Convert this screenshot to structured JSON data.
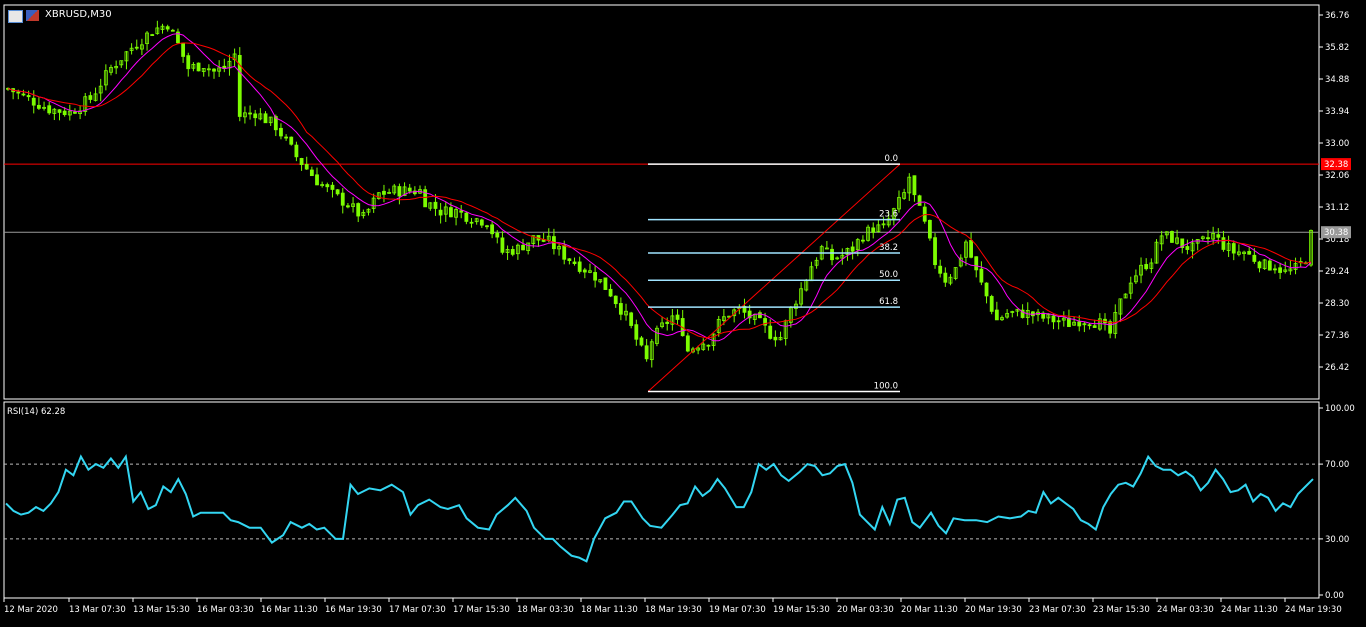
{
  "window": {
    "symbol_timeframe": "XBRUSD,M30"
  },
  "colors": {
    "background": "#000000",
    "frame": "#ffffff",
    "candle": "#7cfc00",
    "ma_fast": "#ff00ff",
    "ma_slow": "#ff0000",
    "price_line": "#ff0000",
    "current_line": "#9a9a9a",
    "fib": "#ffffff",
    "fib_lines": "#a0e4ff",
    "rsi": "#33d6f2",
    "text": "#ffffff",
    "bid_tag_bg": "#ff0000",
    "ask_tag_bg": "#9a9a9a"
  },
  "chart_data": [
    {
      "type": "candlestick",
      "title": "XBRUSD,M30",
      "ylim": [
        25.95,
        36.95
      ],
      "y_ticks": [
        "36.76",
        "35.82",
        "34.88",
        "33.94",
        "33.00",
        "32.06",
        "31.12",
        "30.18",
        "29.24",
        "28.30",
        "27.36",
        "26.42"
      ],
      "x_ticks": [
        "12 Mar 2020",
        "13 Mar 07:30",
        "13 Mar 15:30",
        "16 Mar 03:30",
        "16 Mar 11:30",
        "16 Mar 19:30",
        "17 Mar 07:30",
        "17 Mar 15:30",
        "18 Mar 03:30",
        "18 Mar 11:30",
        "18 Mar 19:30",
        "19 Mar 07:30",
        "19 Mar 15:30",
        "20 Mar 03:30",
        "20 Mar 11:30",
        "20 Mar 19:30",
        "23 Mar 07:30",
        "23 Mar 15:30",
        "24 Mar 03:30",
        "24 Mar 11:30",
        "24 Mar 19:30"
      ],
      "price_levels": [
        {
          "label": "32.38",
          "value": 32.38,
          "role": "bid"
        },
        {
          "label": "30.38",
          "value": 30.38,
          "role": "ask"
        }
      ],
      "fibonacci": {
        "levels": [
          {
            "label": "0.0",
            "value": 32.38
          },
          {
            "label": "23.6",
            "value": 30.75
          },
          {
            "label": "38.2",
            "value": 29.77
          },
          {
            "label": "50.0",
            "value": 28.97
          },
          {
            "label": "61.8",
            "value": 28.18
          },
          {
            "label": "100.0",
            "value": 25.7
          }
        ]
      },
      "price_path": [
        [
          0,
          34.6
        ],
        [
          4,
          34.3
        ],
        [
          8,
          34.0
        ],
        [
          12,
          33.9
        ],
        [
          16,
          34.3
        ],
        [
          20,
          35.2
        ],
        [
          24,
          35.8
        ],
        [
          28,
          36.3
        ],
        [
          31,
          36.5
        ],
        [
          33,
          35.9
        ],
        [
          35,
          35.2
        ],
        [
          38,
          35.3
        ],
        [
          40,
          35.1
        ],
        [
          42,
          35.2
        ],
        [
          44,
          35.6
        ],
        [
          45,
          33.8
        ],
        [
          48,
          33.9
        ],
        [
          52,
          33.5
        ],
        [
          56,
          32.6
        ],
        [
          60,
          31.9
        ],
        [
          63,
          31.5
        ],
        [
          66,
          31.2
        ],
        [
          69,
          30.8
        ],
        [
          72,
          31.5
        ],
        [
          75,
          31.6
        ],
        [
          78,
          31.6
        ],
        [
          80,
          31.6
        ],
        [
          81,
          31.3
        ],
        [
          84,
          31.0
        ],
        [
          87,
          31.0
        ],
        [
          90,
          30.8
        ],
        [
          93,
          30.7
        ],
        [
          96,
          29.8
        ],
        [
          99,
          29.9
        ],
        [
          102,
          30.2
        ],
        [
          105,
          30.1
        ],
        [
          108,
          29.7
        ],
        [
          111,
          29.4
        ],
        [
          114,
          29.1
        ],
        [
          117,
          28.6
        ],
        [
          120,
          27.9
        ],
        [
          123,
          26.9
        ],
        [
          124,
          26.6
        ],
        [
          125,
          27.2
        ],
        [
          127,
          27.6
        ],
        [
          129,
          27.9
        ],
        [
          131,
          27.5
        ],
        [
          132,
          26.9
        ],
        [
          134,
          27.1
        ],
        [
          136,
          27.2
        ],
        [
          138,
          27.7
        ],
        [
          140,
          28.0
        ],
        [
          142,
          28.1
        ],
        [
          144,
          27.9
        ],
        [
          146,
          27.7
        ],
        [
          148,
          27.4
        ],
        [
          150,
          27.3
        ],
        [
          152,
          28.1
        ],
        [
          154,
          28.7
        ],
        [
          156,
          29.4
        ],
        [
          158,
          29.9
        ],
        [
          160,
          29.6
        ],
        [
          162,
          29.7
        ],
        [
          164,
          29.9
        ],
        [
          166,
          30.3
        ],
        [
          168,
          30.5
        ],
        [
          170,
          30.5
        ],
        [
          172,
          31.0
        ],
        [
          174,
          31.5
        ],
        [
          175,
          32.0
        ],
        [
          176,
          31.4
        ],
        [
          178,
          30.6
        ],
        [
          180,
          29.5
        ],
        [
          182,
          29.0
        ],
        [
          184,
          29.3
        ],
        [
          186,
          30.1
        ],
        [
          188,
          29.2
        ],
        [
          190,
          28.5
        ],
        [
          192,
          27.8
        ],
        [
          194,
          28.0
        ],
        [
          196,
          28.0
        ],
        [
          198,
          28.0
        ],
        [
          200,
          27.9
        ],
        [
          203,
          27.8
        ],
        [
          206,
          27.7
        ],
        [
          208,
          27.8
        ],
        [
          210,
          27.8
        ],
        [
          212,
          27.7
        ],
        [
          214,
          27.4
        ],
        [
          216,
          28.3
        ],
        [
          218,
          29.0
        ],
        [
          220,
          29.3
        ],
        [
          222,
          29.6
        ],
        [
          224,
          30.3
        ],
        [
          226,
          30.2
        ],
        [
          228,
          30.0
        ],
        [
          230,
          29.9
        ],
        [
          232,
          30.1
        ],
        [
          234,
          30.3
        ],
        [
          236,
          30.0
        ],
        [
          238,
          29.8
        ],
        [
          240,
          29.8
        ],
        [
          242,
          29.6
        ],
        [
          244,
          29.4
        ],
        [
          246,
          29.4
        ],
        [
          248,
          29.2
        ],
        [
          250,
          29.3
        ],
        [
          252,
          29.6
        ],
        [
          253,
          30.3
        ]
      ],
      "x_count": 253
    },
    {
      "type": "line",
      "title": "RSI(14) 62.28",
      "series": [
        {
          "name": "RSI(14)"
        }
      ],
      "ylim": [
        0,
        100
      ],
      "y_ticks": [
        "100.00",
        "70.00",
        "30.00",
        "0.00"
      ],
      "levels": [
        70,
        30
      ],
      "values_path": [
        [
          0,
          49
        ],
        [
          2,
          45
        ],
        [
          4,
          43
        ],
        [
          6,
          44
        ],
        [
          8,
          47
        ],
        [
          10,
          45
        ],
        [
          12,
          49
        ],
        [
          14,
          55
        ],
        [
          16,
          67
        ],
        [
          18,
          64
        ],
        [
          20,
          74
        ],
        [
          22,
          67
        ],
        [
          24,
          70
        ],
        [
          26,
          68
        ],
        [
          28,
          73
        ],
        [
          30,
          68
        ],
        [
          32,
          74
        ],
        [
          34,
          50
        ],
        [
          36,
          55
        ],
        [
          38,
          46
        ],
        [
          40,
          48
        ],
        [
          42,
          58
        ],
        [
          44,
          55
        ],
        [
          46,
          62
        ],
        [
          48,
          54
        ],
        [
          50,
          42
        ],
        [
          52,
          44
        ],
        [
          55,
          44
        ],
        [
          58,
          44
        ],
        [
          60,
          40
        ],
        [
          62,
          39
        ],
        [
          65,
          36
        ],
        [
          68,
          36
        ],
        [
          71,
          28
        ],
        [
          74,
          32
        ],
        [
          76,
          39
        ],
        [
          79,
          36
        ],
        [
          81,
          38
        ],
        [
          83,
          35
        ],
        [
          85,
          36
        ],
        [
          88,
          30
        ],
        [
          90,
          30
        ],
        [
          92,
          59
        ],
        [
          94,
          54
        ],
        [
          97,
          57
        ],
        [
          100,
          56
        ],
        [
          103,
          59
        ],
        [
          106,
          55
        ],
        [
          108,
          43
        ],
        [
          110,
          48
        ],
        [
          113,
          51
        ],
        [
          116,
          47
        ],
        [
          118,
          46
        ],
        [
          121,
          48
        ],
        [
          123,
          41
        ],
        [
          126,
          36
        ],
        [
          129,
          35
        ],
        [
          131,
          43
        ],
        [
          134,
          48
        ],
        [
          136,
          52
        ],
        [
          139,
          45
        ],
        [
          141,
          36
        ],
        [
          144,
          30
        ],
        [
          146,
          30
        ],
        [
          148,
          26
        ],
        [
          151,
          21
        ],
        [
          153,
          20
        ],
        [
          155,
          18
        ],
        [
          157,
          30
        ],
        [
          160,
          41
        ],
        [
          163,
          44
        ],
        [
          165,
          50
        ],
        [
          167,
          50
        ],
        [
          170,
          41
        ],
        [
          172,
          37
        ],
        [
          175,
          36
        ],
        [
          178,
          43
        ],
        [
          180,
          48
        ],
        [
          182,
          49
        ],
        [
          184,
          58
        ],
        [
          186,
          53
        ],
        [
          188,
          56
        ],
        [
          190,
          62
        ],
        [
          192,
          57
        ],
        [
          195,
          47
        ],
        [
          197,
          47
        ],
        [
          199,
          55
        ],
        [
          201,
          70
        ],
        [
          203,
          67
        ],
        [
          205,
          70
        ],
        [
          207,
          64
        ],
        [
          209,
          61
        ],
        [
          212,
          66
        ],
        [
          214,
          70
        ],
        [
          216,
          69
        ],
        [
          218,
          64
        ],
        [
          220,
          65
        ],
        [
          222,
          69
        ],
        [
          224,
          70
        ],
        [
          226,
          60
        ],
        [
          228,
          43
        ],
        [
          230,
          39
        ],
        [
          232,
          35
        ],
        [
          234,
          47
        ],
        [
          236,
          38
        ],
        [
          238,
          51
        ],
        [
          240,
          52
        ],
        [
          242,
          39
        ],
        [
          244,
          36
        ],
        [
          247,
          44
        ],
        [
          249,
          37
        ],
        [
          251,
          33
        ],
        [
          253,
          41
        ],
        [
          256,
          40
        ],
        [
          259,
          40
        ],
        [
          262,
          39
        ],
        [
          265,
          42
        ],
        [
          268,
          41
        ],
        [
          271,
          42
        ],
        [
          273,
          45
        ],
        [
          275,
          44
        ],
        [
          277,
          55
        ],
        [
          279,
          49
        ],
        [
          281,
          52
        ],
        [
          283,
          49
        ],
        [
          285,
          46
        ],
        [
          287,
          40
        ],
        [
          289,
          38
        ],
        [
          291,
          35
        ],
        [
          293,
          47
        ],
        [
          295,
          54
        ],
        [
          297,
          59
        ],
        [
          299,
          60
        ],
        [
          301,
          58
        ],
        [
          303,
          65
        ],
        [
          305,
          74
        ],
        [
          307,
          69
        ],
        [
          309,
          67
        ],
        [
          311,
          67
        ],
        [
          313,
          64
        ],
        [
          315,
          66
        ],
        [
          317,
          63
        ],
        [
          319,
          56
        ],
        [
          321,
          60
        ],
        [
          323,
          67
        ],
        [
          325,
          62
        ],
        [
          327,
          55
        ],
        [
          329,
          56
        ],
        [
          331,
          59
        ],
        [
          333,
          50
        ],
        [
          335,
          54
        ],
        [
          337,
          52
        ],
        [
          339,
          45
        ],
        [
          341,
          49
        ],
        [
          343,
          47
        ],
        [
          345,
          54
        ],
        [
          347,
          58
        ],
        [
          349,
          62
        ]
      ],
      "x_count": 349
    }
  ]
}
